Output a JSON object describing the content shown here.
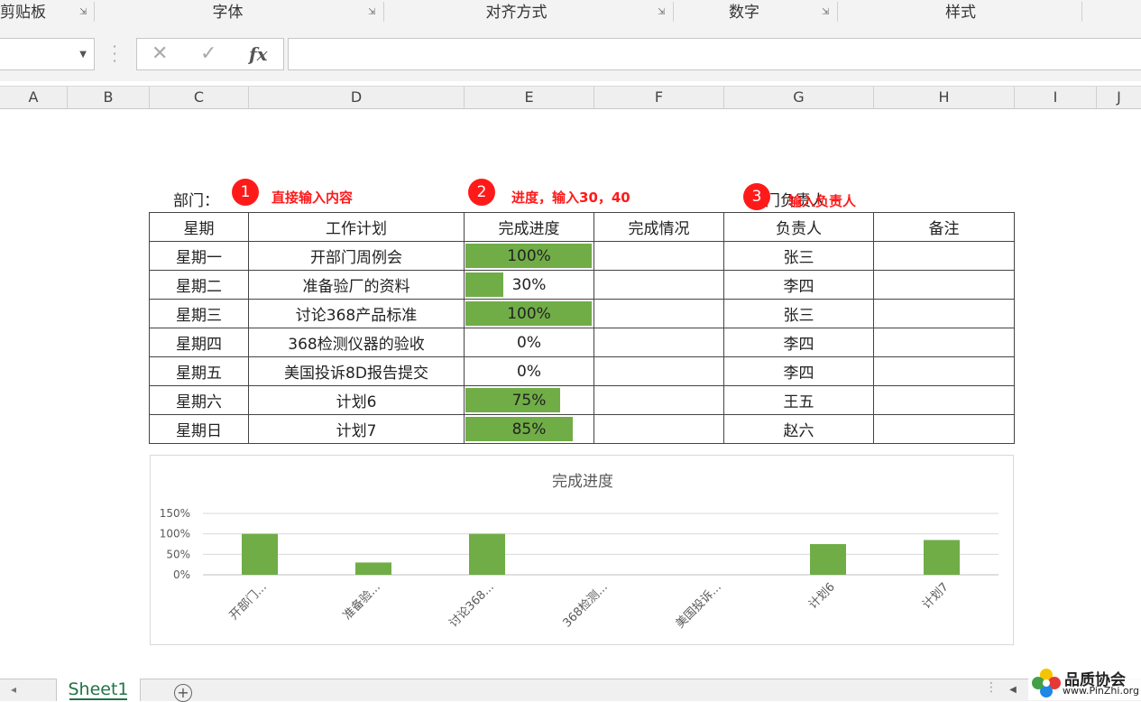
{
  "ribbon": {
    "groups": [
      "剪贴板",
      "字体",
      "对齐方式",
      "数字",
      "样式"
    ]
  },
  "formula_bar": {
    "name_box_value": "",
    "cancel_icon": "x-icon",
    "enter_icon": "check-icon",
    "fx_label": "fx",
    "formula_value": ""
  },
  "columns": [
    "A",
    "B",
    "C",
    "D",
    "E",
    "F",
    "G",
    "H",
    "I",
    "J"
  ],
  "annotations": {
    "dept_label": "部门：",
    "badge1": "1",
    "note1": "直接输入内容",
    "badge2": "2",
    "note2": "进度，输入30，40",
    "dept_label2": "门负责人",
    "badge3": "3",
    "note3": "输入负责人"
  },
  "table": {
    "headers": [
      "星期",
      "工作计划",
      "完成进度",
      "完成情况",
      "负责人",
      "备注"
    ],
    "rows": [
      {
        "day": "星期一",
        "plan": "开部门周例会",
        "progress": "100%",
        "progress_value": 1.0,
        "status": "",
        "owner": "张三",
        "note": ""
      },
      {
        "day": "星期二",
        "plan": "准备验厂的资料",
        "progress": "30%",
        "progress_value": 0.3,
        "status": "",
        "owner": "李四",
        "note": ""
      },
      {
        "day": "星期三",
        "plan": "讨论368产品标准",
        "progress": "100%",
        "progress_value": 1.0,
        "status": "",
        "owner": "张三",
        "note": ""
      },
      {
        "day": "星期四",
        "plan": "368检测仪器的验收",
        "progress": "0%",
        "progress_value": 0.0,
        "status": "",
        "owner": "李四",
        "note": ""
      },
      {
        "day": "星期五",
        "plan": "美国投诉8D报告提交",
        "progress": "0%",
        "progress_value": 0.0,
        "status": "",
        "owner": "李四",
        "note": ""
      },
      {
        "day": "星期六",
        "plan": "计划6",
        "progress": "75%",
        "progress_value": 0.75,
        "status": "",
        "owner": "王五",
        "note": ""
      },
      {
        "day": "星期日",
        "plan": "计划7",
        "progress": "85%",
        "progress_value": 0.85,
        "status": "",
        "owner": "赵六",
        "note": ""
      }
    ]
  },
  "chart_data": {
    "type": "bar",
    "title": "完成进度",
    "categories": [
      "开部门...",
      "准备验...",
      "讨论368...",
      "368检测...",
      "美国投诉...",
      "计划6",
      "计划7"
    ],
    "values": [
      100,
      30,
      100,
      0,
      0,
      75,
      85
    ],
    "yticks": [
      "0%",
      "50%",
      "100%",
      "150%"
    ],
    "ylim": [
      0,
      150
    ],
    "grid": true,
    "color": "#70ad47"
  },
  "sheets": {
    "active": "Sheet1"
  },
  "watermark": {
    "title": "品质协会",
    "url": "www.PinZhi.org"
  },
  "colors": {
    "accent": "#217346",
    "bar": "#70ad47",
    "annotation": "#ff1a1a"
  }
}
